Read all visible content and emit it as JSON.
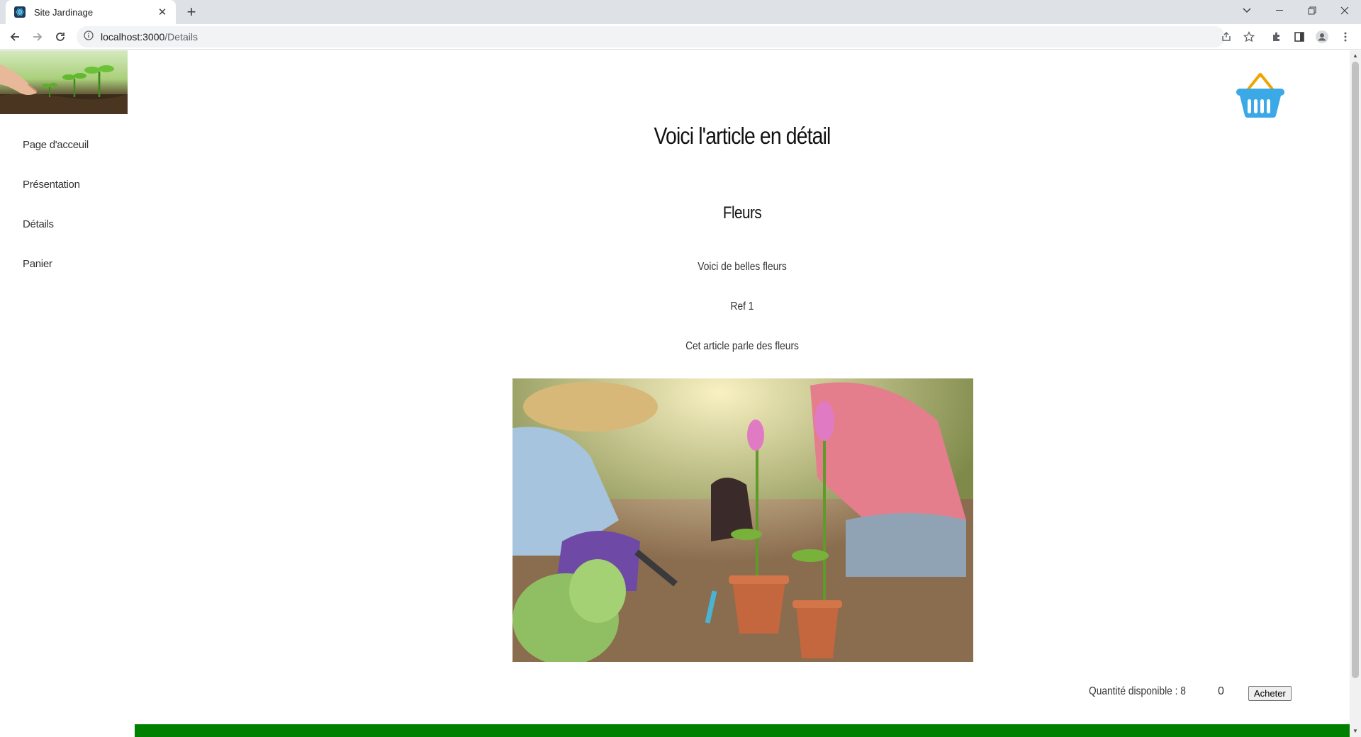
{
  "browser": {
    "tab_title": "Site Jardinage",
    "url_host": "localhost:3000",
    "url_path": "/Details"
  },
  "sidebar": {
    "items": [
      {
        "label": "Page d'acceuil"
      },
      {
        "label": "Présentation"
      },
      {
        "label": "Détails"
      },
      {
        "label": "Panier"
      }
    ]
  },
  "article": {
    "page_title": "Voici l'article en détail",
    "name": "Fleurs",
    "description": "Voici de belles fleurs",
    "reference": "Ref 1",
    "summary": "Cet article parle des fleurs"
  },
  "purchase": {
    "available_label": "Quantité disponible : 8",
    "quantity": "0",
    "buy_label": "Acheter"
  },
  "colors": {
    "footer": "#008000",
    "basket": "#3aa9e6",
    "basket_handle": "#f0a400"
  }
}
